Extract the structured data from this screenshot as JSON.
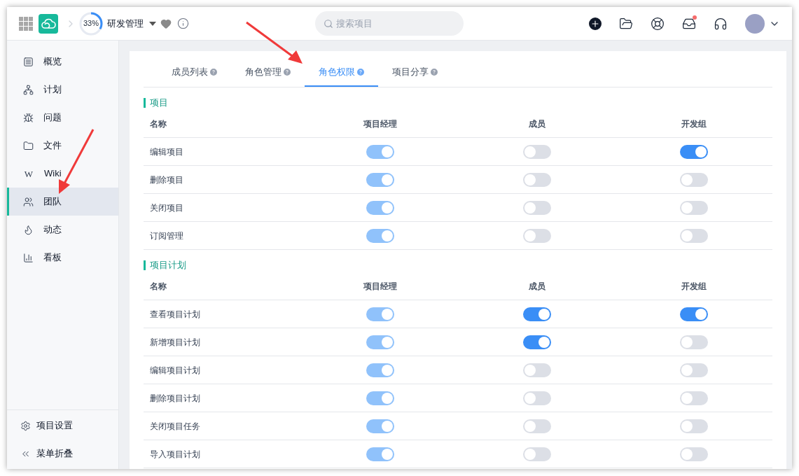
{
  "header": {
    "project_progress": {
      "level": 0.33,
      "label": "33%"
    },
    "project_name": "研发管理",
    "search": {
      "placeholder": "搜索项目"
    },
    "inbox_has_notification": true
  },
  "sidebar": {
    "items": [
      {
        "label": "概览",
        "selected": false
      },
      {
        "label": "计划",
        "selected": false
      },
      {
        "label": "问题",
        "selected": false
      },
      {
        "label": "文件",
        "selected": false
      },
      {
        "label": "Wiki",
        "icon_char": "W",
        "selected": false
      },
      {
        "label": "团队",
        "selected": true
      },
      {
        "label": "动态",
        "selected": false
      },
      {
        "label": "看板",
        "selected": false
      }
    ],
    "footer": [
      {
        "label": "项目设置"
      },
      {
        "label": "菜单折叠"
      }
    ]
  },
  "tabs": [
    {
      "label": "成员列表",
      "selected": false
    },
    {
      "label": "角色管理",
      "selected": false
    },
    {
      "label": "角色权限",
      "selected": true
    },
    {
      "label": "项目分享",
      "selected": false
    }
  ],
  "sections": [
    {
      "title": "项目",
      "columns": [
        "名称",
        "项目经理",
        "成员",
        "开发组"
      ],
      "rows": [
        {
          "name": "编辑项目",
          "toggles": [
            {
              "on": true,
              "disabled": true
            },
            {
              "on": false,
              "disabled": false
            },
            {
              "on": true,
              "disabled": false
            }
          ]
        },
        {
          "name": "删除项目",
          "toggles": [
            {
              "on": true,
              "disabled": true
            },
            {
              "on": false,
              "disabled": false
            },
            {
              "on": false,
              "disabled": false
            }
          ]
        },
        {
          "name": "关闭项目",
          "toggles": [
            {
              "on": true,
              "disabled": true
            },
            {
              "on": false,
              "disabled": false
            },
            {
              "on": false,
              "disabled": false
            }
          ]
        },
        {
          "name": "订阅管理",
          "toggles": [
            {
              "on": true,
              "disabled": true
            },
            {
              "on": false,
              "disabled": false
            },
            {
              "on": false,
              "disabled": false
            }
          ]
        }
      ]
    },
    {
      "title": "项目计划",
      "columns": [
        "名称",
        "项目经理",
        "成员",
        "开发组"
      ],
      "rows": [
        {
          "name": "查看项目计划",
          "toggles": [
            {
              "on": true,
              "disabled": true
            },
            {
              "on": true,
              "disabled": false
            },
            {
              "on": true,
              "disabled": false
            }
          ]
        },
        {
          "name": "新增项目计划",
          "toggles": [
            {
              "on": true,
              "disabled": true
            },
            {
              "on": true,
              "disabled": false
            },
            {
              "on": false,
              "disabled": false
            }
          ]
        },
        {
          "name": "编辑项目计划",
          "toggles": [
            {
              "on": true,
              "disabled": true
            },
            {
              "on": false,
              "disabled": false
            },
            {
              "on": false,
              "disabled": false
            }
          ]
        },
        {
          "name": "删除项目计划",
          "toggles": [
            {
              "on": true,
              "disabled": true
            },
            {
              "on": false,
              "disabled": false
            },
            {
              "on": false,
              "disabled": false
            }
          ]
        },
        {
          "name": "关闭项目任务",
          "toggles": [
            {
              "on": true,
              "disabled": true
            },
            {
              "on": false,
              "disabled": false
            },
            {
              "on": false,
              "disabled": false
            }
          ]
        },
        {
          "name": "导入项目计划",
          "toggles": [
            {
              "on": true,
              "disabled": true
            },
            {
              "on": false,
              "disabled": false
            },
            {
              "on": false,
              "disabled": false
            }
          ]
        }
      ]
    }
  ]
}
